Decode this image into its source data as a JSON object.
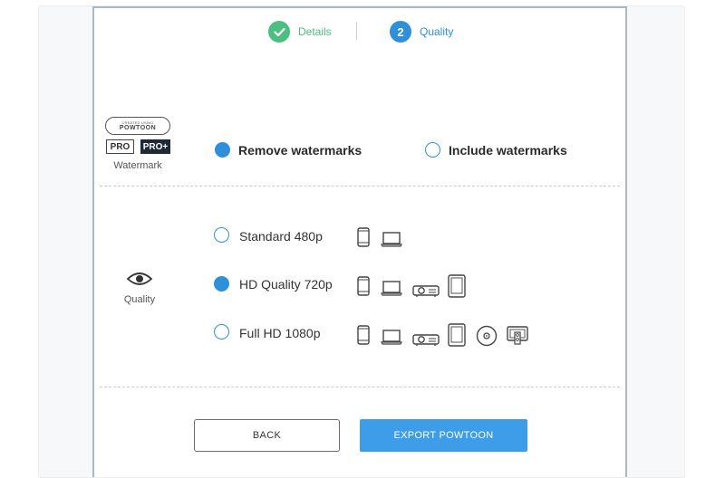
{
  "stepper": {
    "steps": [
      {
        "label": "Details",
        "state": "done"
      },
      {
        "label": "Quality",
        "number": "2",
        "state": "current"
      }
    ]
  },
  "watermark": {
    "badge_small": "CREATED USING",
    "badge_big": "POWTOON",
    "tags": [
      "PRO",
      "PRO+"
    ],
    "caption": "Watermark",
    "options": [
      {
        "label": "Remove watermarks",
        "selected": true
      },
      {
        "label": "Include watermarks",
        "selected": false
      }
    ]
  },
  "quality": {
    "caption": "Quality",
    "options": [
      {
        "label": "Standard 480p",
        "selected": false,
        "devices": [
          "phone-icon",
          "laptop-icon"
        ]
      },
      {
        "label": "HD Quality 720p",
        "selected": true,
        "devices": [
          "phone-icon",
          "laptop-icon",
          "projector-icon",
          "tablet-icon"
        ]
      },
      {
        "label": "Full HD 1080p",
        "selected": false,
        "devices": [
          "phone-icon",
          "laptop-icon",
          "projector-icon",
          "tablet-icon",
          "disc-icon",
          "tv-icon"
        ]
      }
    ]
  },
  "buttons": {
    "back": "BACK",
    "export": "EXPORT POWTOON"
  },
  "colors": {
    "accent": "#2f8fd9",
    "done": "#4cbf80",
    "export_button": "#3d9de8",
    "dialog_border": "#aab8c4"
  }
}
